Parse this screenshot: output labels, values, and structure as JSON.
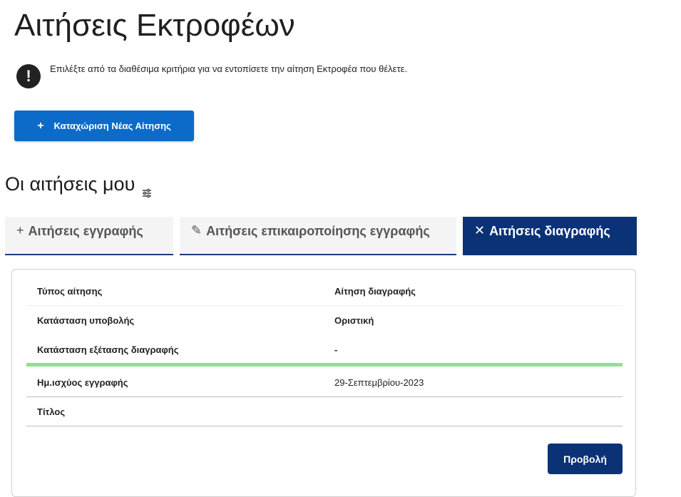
{
  "page": {
    "title": "Αιτήσεις Εκτροφέων",
    "info_icon": "exclamation-icon",
    "info_text": "Επιλέξτε από τα διαθέσιμα κριτήρια για να εντοπίσετε την αίτηση Εκτροφέα που θέλετε.",
    "new_button": {
      "icon": "+",
      "label": "Καταχώριση Νέας Αίτησης"
    }
  },
  "section": {
    "title": "Οι αιτήσεις μου",
    "filter_icon": "sliders-icon"
  },
  "tabs": [
    {
      "icon": "+",
      "label": "Αιτήσεις εγγραφής",
      "active": false
    },
    {
      "icon": "✎",
      "label": "Αιτήσεις επικαιροποίησης εγγραφής",
      "active": false
    },
    {
      "icon": "✕",
      "label": "Αιτήσεις διαγραφής",
      "active": true
    }
  ],
  "card": {
    "rows": [
      {
        "key": "Τύπος αίτησης",
        "value": "Αίτηση διαγραφής"
      },
      {
        "key": "Κατάσταση υποβολής",
        "value": "Οριστική"
      },
      {
        "key": "Κατάσταση εξέτασης διαγραφής",
        "value": "-"
      },
      {
        "key": "Ημ.ισχύος εγγραφής",
        "value": "29-Σεπτεμβρίου-2023"
      },
      {
        "key": "Τίτλος",
        "value": ""
      }
    ],
    "view_button": "Προβολή"
  },
  "colors": {
    "primary_button": "#0c6bc9",
    "active_tab": "#0b3276",
    "status_bar": "#8ee28e"
  }
}
